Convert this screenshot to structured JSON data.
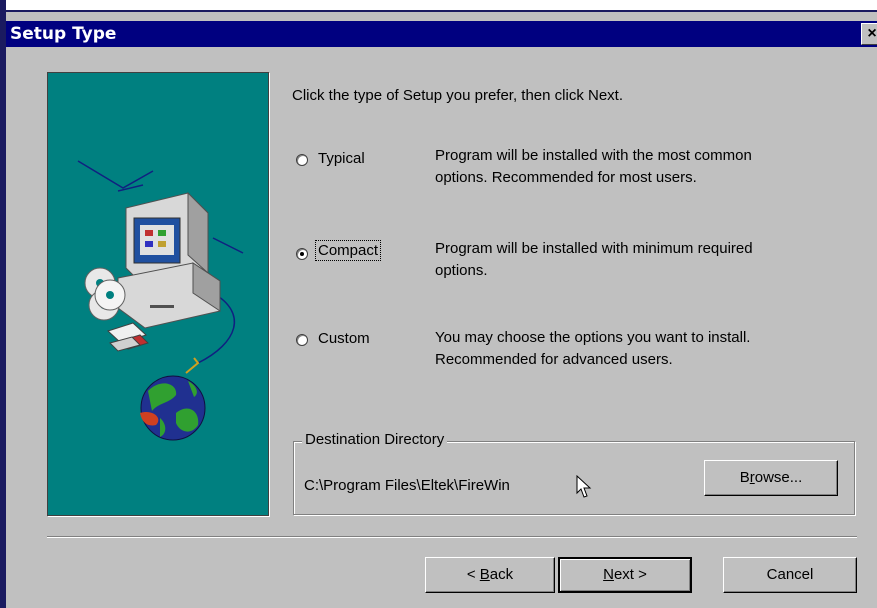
{
  "window": {
    "title": "Setup Type",
    "close_glyph": "×"
  },
  "main": {
    "instruction": "Click the type of Setup you prefer, then click Next.",
    "options": [
      {
        "label": "Typical",
        "desc_line1": "Program will be installed with the most common",
        "desc_line2": "options. Recommended for most users.",
        "selected": false
      },
      {
        "label": "Compact",
        "desc_line1": "Program will be installed with minimum required",
        "desc_line2": "options.",
        "selected": true
      },
      {
        "label": "Custom",
        "desc_line1": "You may choose the options you want to install.",
        "desc_line2": "Recommended for advanced users.",
        "selected": false
      }
    ]
  },
  "destination": {
    "legend": "Destination Directory",
    "path": "C:\\Program Files\\Eltek\\FireWin",
    "browse_pre": "B",
    "browse_u": "r",
    "browse_post": "owse..."
  },
  "buttons": {
    "back_arrow": "< ",
    "back_u": "B",
    "back_post": "ack",
    "next_u": "N",
    "next_post": "ext >",
    "cancel": "Cancel"
  },
  "colors": {
    "title_bar": "#000080",
    "dialog_bg": "#c0c0c0",
    "banner_bg": "#008080"
  },
  "icons": [
    "computer-illustration",
    "cd-disc-icon",
    "floppy-disk-icon",
    "globe-icon",
    "close-icon",
    "radio-button",
    "mouse-cursor-icon"
  ]
}
